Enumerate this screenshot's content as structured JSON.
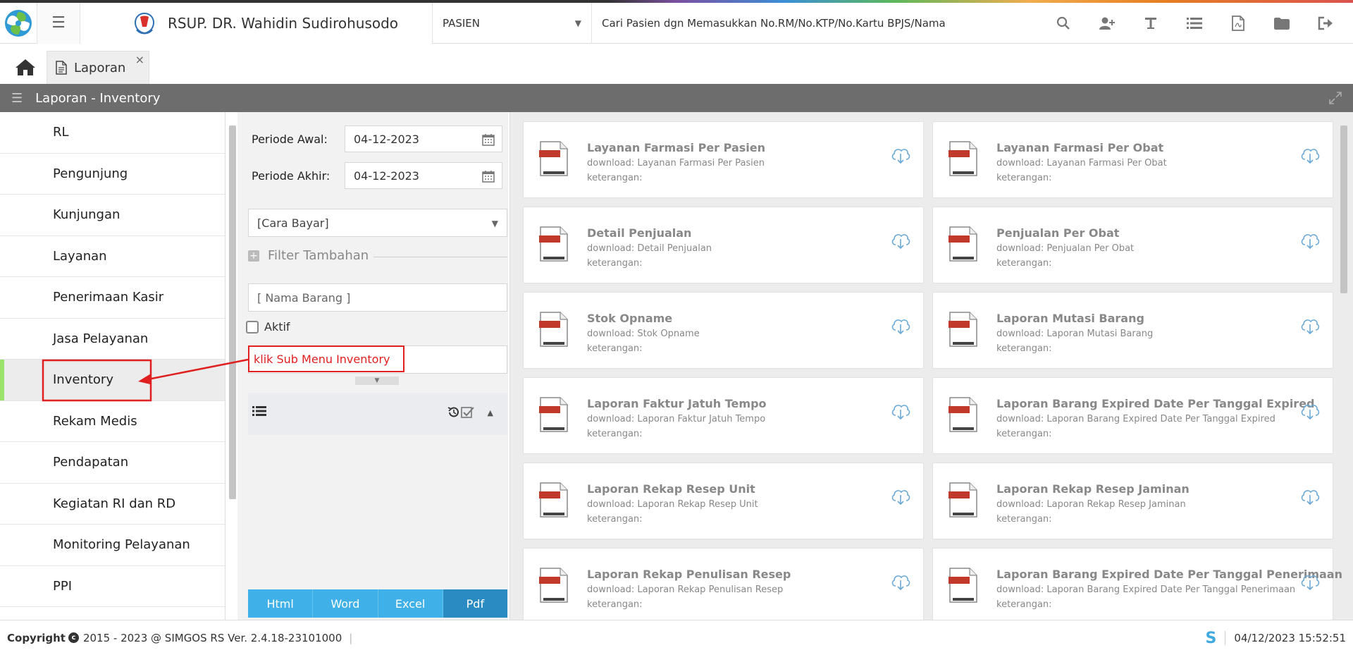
{
  "header": {
    "hospital_name": "RSUP. DR. Wahidin Sudirohusodo",
    "patient_filter": "PASIEN",
    "search_placeholder": "Cari Pasien dgn Memasukkan No.RM/No.KTP/No.Kartu BPJS/Nama"
  },
  "tabs": {
    "active_label": "Laporan",
    "close": "×"
  },
  "titlebar": {
    "title": "Laporan - Inventory"
  },
  "nav": {
    "items": [
      {
        "label": "RL"
      },
      {
        "label": "Pengunjung"
      },
      {
        "label": "Kunjungan"
      },
      {
        "label": "Layanan"
      },
      {
        "label": "Penerimaan Kasir"
      },
      {
        "label": "Jasa Pelayanan"
      },
      {
        "label": "Inventory"
      },
      {
        "label": "Rekam Medis"
      },
      {
        "label": "Pendapatan"
      },
      {
        "label": "Kegiatan RI dan RD"
      },
      {
        "label": "Monitoring Pelayanan"
      },
      {
        "label": "PPI"
      }
    ],
    "active": "Inventory"
  },
  "filter": {
    "periode_awal_label": "Periode Awal:",
    "periode_awal_value": "04-12-2023",
    "periode_akhir_label": "Periode Akhir:",
    "periode_akhir_value": "04-12-2023",
    "cara_bayar": "[Cara Bayar]",
    "filter_tambahan": "Filter Tambahan",
    "nama_barang_placeholder": "[ Nama Barang ]",
    "aktif_label": "Aktif",
    "annotation": "klik Sub Menu Inventory",
    "export": [
      "Html",
      "Word",
      "Excel",
      "Pdf"
    ]
  },
  "reports": [
    {
      "title": "Layanan Farmasi Per Pasien",
      "download": "download: Layanan Farmasi Per Pasien",
      "keterangan": "keterangan:"
    },
    {
      "title": "Layanan Farmasi Per Obat",
      "download": "download: Layanan Farmasi Per Obat",
      "keterangan": "keterangan:"
    },
    {
      "title": "Detail Penjualan",
      "download": "download: Detail Penjualan",
      "keterangan": "keterangan:"
    },
    {
      "title": "Penjualan Per Obat",
      "download": "download: Penjualan Per Obat",
      "keterangan": "keterangan:"
    },
    {
      "title": "Stok Opname",
      "download": "download: Stok Opname",
      "keterangan": "keterangan:"
    },
    {
      "title": "Laporan Mutasi Barang",
      "download": "download: Laporan Mutasi Barang",
      "keterangan": "keterangan:"
    },
    {
      "title": "Laporan Faktur Jatuh Tempo",
      "download": "download: Laporan Faktur Jatuh Tempo",
      "keterangan": "keterangan:"
    },
    {
      "title": "Laporan Barang Expired Date Per Tanggal Expired",
      "download": "download: Laporan Barang Expired Date Per Tanggal Expired",
      "keterangan": "keterangan:"
    },
    {
      "title": "Laporan Rekap Resep Unit",
      "download": "download: Laporan Rekap Resep Unit",
      "keterangan": "keterangan:"
    },
    {
      "title": "Laporan Rekap Resep Jaminan",
      "download": "download: Laporan Rekap Resep Jaminan",
      "keterangan": "keterangan:"
    },
    {
      "title": "Laporan Rekap Penulisan Resep",
      "download": "download: Laporan Rekap Penulisan Resep",
      "keterangan": "keterangan:"
    },
    {
      "title": "Laporan Barang Expired Date Per Tanggal Penerimaan",
      "download": "download: Laporan Barang Expired Date Per Tanggal Penerimaan",
      "keterangan": "keterangan:"
    }
  ],
  "footer": {
    "copyright_label": "Copyright",
    "copyright_text": "2015 - 2023 @ SIMGOS RS Ver. 2.4.18-23101000",
    "separator": "|",
    "logo_letter": "S",
    "datetime": "04/12/2023 15:52:51"
  },
  "colors": {
    "accent_blue": "#3fb1e8",
    "annotation_red": "#e02020",
    "active_nav_marker": "#9be36b",
    "titlebar_gray": "#6d6d6d"
  }
}
